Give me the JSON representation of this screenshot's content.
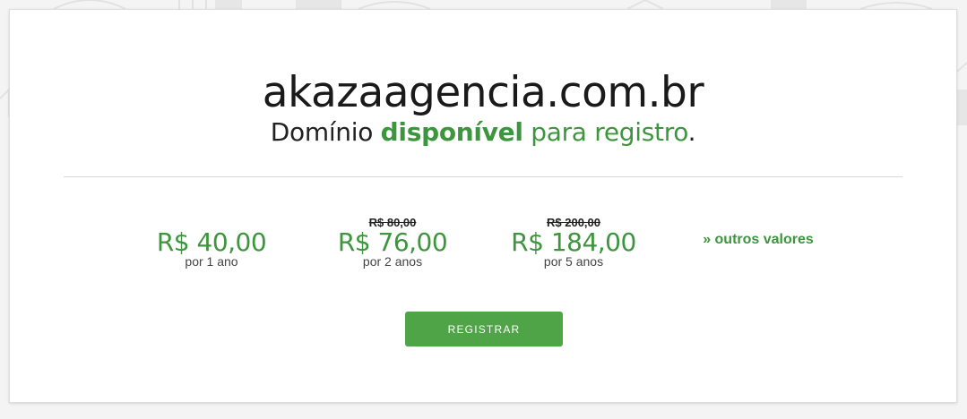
{
  "domain": {
    "name": "akazaagencia.com.br",
    "status_prefix": "Domínio",
    "status_keyword": "disponível",
    "status_suffix": "para registro",
    "status_end": "."
  },
  "prices": [
    {
      "old_price": "",
      "price": "R$ 40,00",
      "period": "por 1 ano"
    },
    {
      "old_price": "R$ 80,00",
      "price": "R$ 76,00",
      "period": "por 2 anos"
    },
    {
      "old_price": "R$ 200,00",
      "price": "R$ 184,00",
      "period": "por 5 anos"
    }
  ],
  "other_values_link": "» outros valores",
  "register_button": "REGISTRAR",
  "colors": {
    "accent_green": "#3d963d",
    "button_green": "#4ea447",
    "text_dark": "#1a1a1a"
  }
}
